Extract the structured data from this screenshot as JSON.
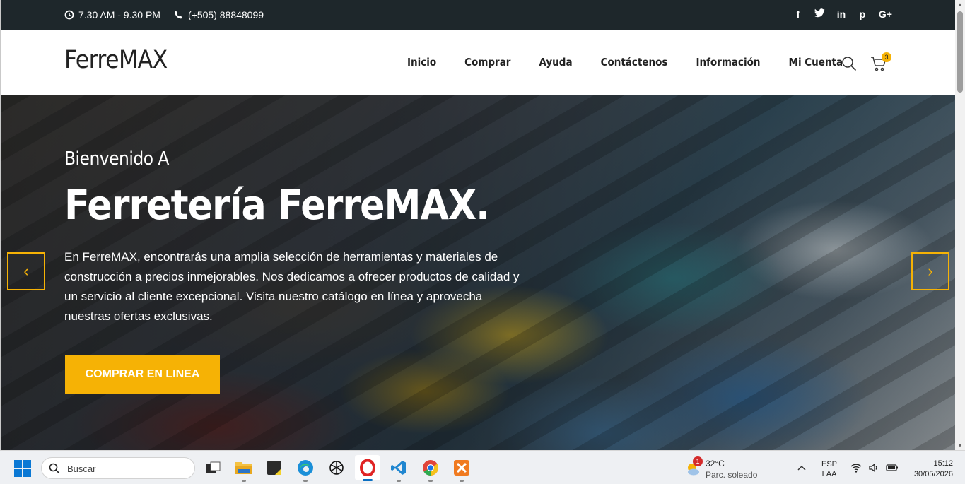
{
  "topbar": {
    "hours": "7.30 AM - 9.30 PM",
    "phone": "(+505) 88848099",
    "socials": [
      "f",
      "t",
      "in",
      "p",
      "G+"
    ]
  },
  "navbar": {
    "logo": "FerreMAX",
    "menu": [
      "Inicio",
      "Comprar",
      "Ayuda",
      "Contáctenos",
      "Información",
      "Mi Cuenta"
    ],
    "cart_count": "3"
  },
  "hero": {
    "welcome": "Bienvenido A",
    "title": "Ferretería FerreMAX.",
    "description": "En FerreMAX, encontrarás una amplia selección de herramientas y materiales de construcción a precios inmejorables. Nos dedicamos a ofrecer productos de calidad y un servicio al cliente excepcional. Visita nuestro catálogo en línea y aprovecha nuestras ofertas exclusivas.",
    "cta": "COMPRAR EN LINEA",
    "prev": "‹",
    "next": "›"
  },
  "colors": {
    "accent": "#f6b205",
    "topbar_bg": "#1e272b"
  },
  "taskbar": {
    "search_placeholder": "Buscar",
    "apps": [
      "task-view",
      "file-explorer",
      "sticky-notes",
      "edge",
      "chatgpt",
      "opera",
      "vscode",
      "chrome",
      "xampp"
    ],
    "active_app": "opera",
    "weather": {
      "temp": "32°C",
      "condition": "Parc. soleado",
      "badge": "1"
    },
    "lang_1": "ESP",
    "lang_2": "LAA",
    "time": "15:12",
    "date": "30/05/2026"
  }
}
